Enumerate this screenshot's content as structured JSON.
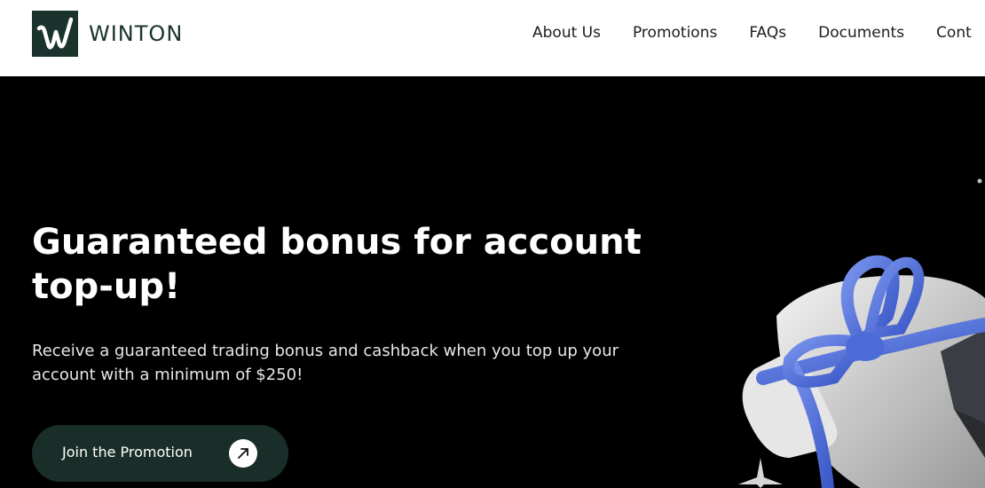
{
  "brand": {
    "name": "WINTON"
  },
  "nav": {
    "items": [
      {
        "label": "About Us"
      },
      {
        "label": "Promotions"
      },
      {
        "label": "FAQs"
      },
      {
        "label": "Documents"
      },
      {
        "label": "Cont"
      }
    ]
  },
  "hero": {
    "title": "Guaranteed bonus for account top-up!",
    "description": "Receive a guaranteed trading bonus and cashback when you top up your account with a minimum of $250!",
    "cta_label": "Join the Promotion"
  },
  "icons": {
    "logo": "winton-w-logo-icon",
    "cta": "arrow-up-right-icon",
    "illustration": "gift-box-illustration",
    "sparkle": "sparkle-icon"
  },
  "colors": {
    "brand_dark_green": "#1a332d",
    "hero_bg": "#000000",
    "cta_bg": "#1a2e29",
    "ribbon_blue": "#5a7be0",
    "text_light": "#ffffff"
  }
}
